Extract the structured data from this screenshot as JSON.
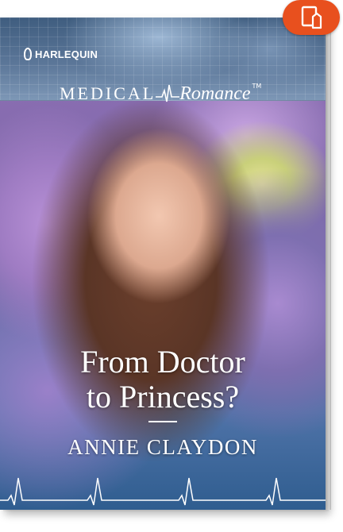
{
  "cover": {
    "publisher": "HARLEQUIN",
    "line_left": "MEDICAL",
    "line_right": "Romance",
    "trademark": "TM",
    "title_line1": "From Doctor",
    "title_line2": "to Princess?",
    "author": "ANNIE CLAYDON"
  },
  "icons": {
    "badge": "book-reader-icon",
    "logo": "harlequin-rose-icon",
    "heartbeat": "heartbeat-line-icon"
  },
  "colors": {
    "badge_bg": "#e8501e",
    "header_bg": "#4f6b8e",
    "text": "#ffffff"
  }
}
